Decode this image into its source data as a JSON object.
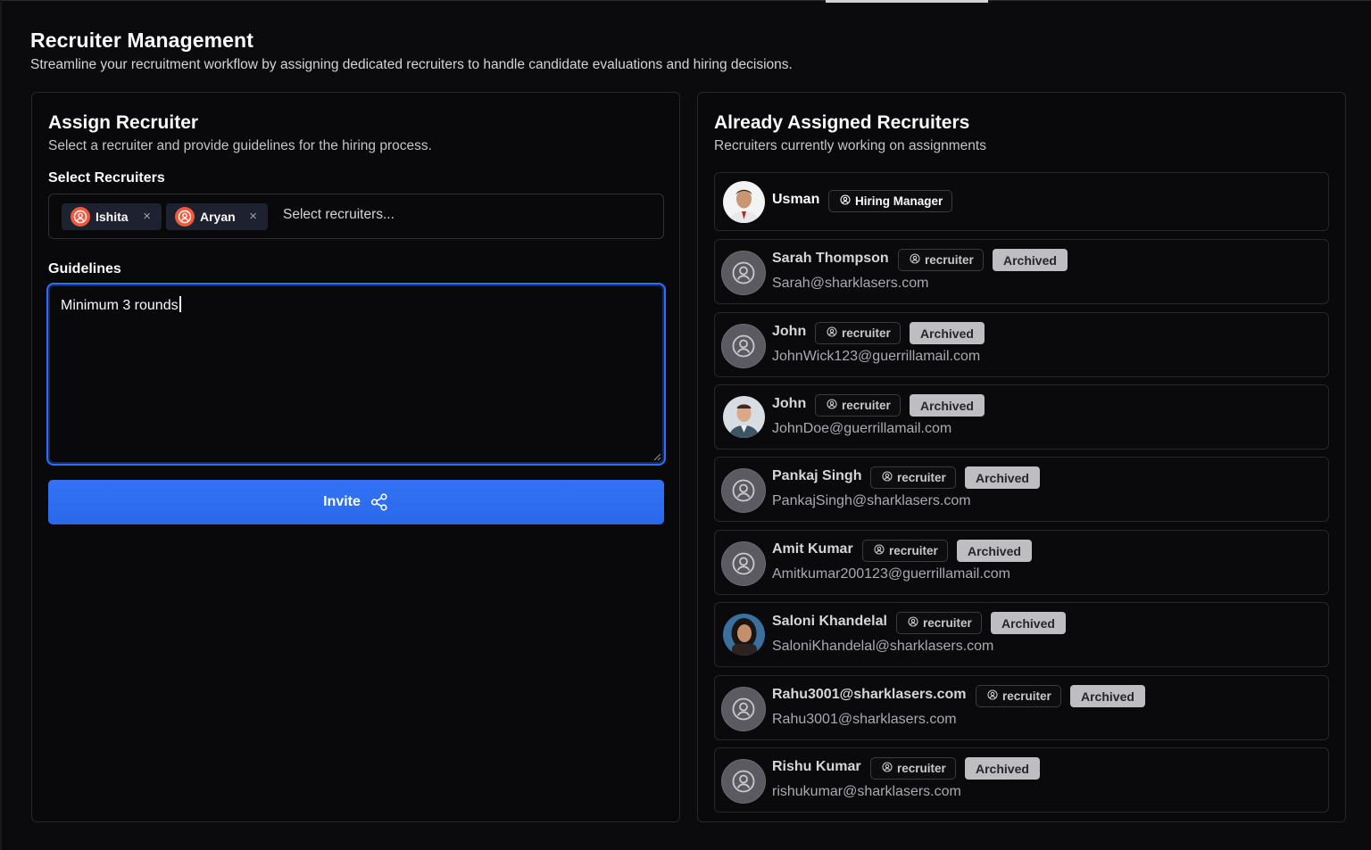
{
  "header": {
    "title": "Recruiter Management",
    "subtitle": "Streamline your recruitment workflow by assigning dedicated recruiters to handle candidate evaluations and hiring decisions."
  },
  "assign": {
    "title": "Assign Recruiter",
    "description": "Select a recruiter and provide guidelines for the hiring process.",
    "select_label": "Select Recruiters",
    "selected": [
      "Ishita",
      "Aryan"
    ],
    "select_placeholder": "Select recruiters...",
    "remove_symbol": "×",
    "guidelines_label": "Guidelines",
    "guidelines_value": "Minimum 3 rounds",
    "invite_label": "Invite"
  },
  "assigned": {
    "title": "Already Assigned Recruiters",
    "description": "Recruiters currently working on assignments",
    "items": [
      {
        "name": "Usman",
        "role": "Hiring Manager",
        "avatar": "photo-man"
      },
      {
        "name": "Sarah Thompson",
        "role": "recruiter",
        "status": "Archived",
        "email": "Sarah@sharklasers.com",
        "avatar": "user-circle-icon"
      },
      {
        "name": "John",
        "role": "recruiter",
        "status": "Archived",
        "email": "JohnWick123@guerrillamail.com",
        "avatar": "user-circle-icon"
      },
      {
        "name": "John",
        "role": "recruiter",
        "status": "Archived",
        "email": "JohnDoe@guerrillamail.com",
        "avatar": "photo-man-suit"
      },
      {
        "name": "Pankaj Singh",
        "role": "recruiter",
        "status": "Archived",
        "email": "PankajSingh@sharklasers.com",
        "avatar": "user-circle-icon"
      },
      {
        "name": "Amit Kumar",
        "role": "recruiter",
        "status": "Archived",
        "email": "Amitkumar200123@guerrillamail.com",
        "avatar": "user-circle-icon"
      },
      {
        "name": "Saloni Khandelal",
        "role": "recruiter",
        "status": "Archived",
        "email": "SaloniKhandelal@sharklasers.com",
        "avatar": "photo-woman"
      },
      {
        "name": "Rahu3001@sharklasers.com",
        "role": "recruiter",
        "status": "Archived",
        "email": "Rahu3001@sharklasers.com",
        "avatar": "user-circle-icon"
      },
      {
        "name": "Rishu Kumar",
        "role": "recruiter",
        "status": "Archived",
        "email": "rishukumar@sharklasers.com",
        "avatar": "user-circle-icon"
      }
    ]
  },
  "colors": {
    "background": "#0b0b0d",
    "accent": "#2c6df0",
    "chip_avatar": "#f05a3b",
    "archived_bg": "#bdbdc2"
  }
}
